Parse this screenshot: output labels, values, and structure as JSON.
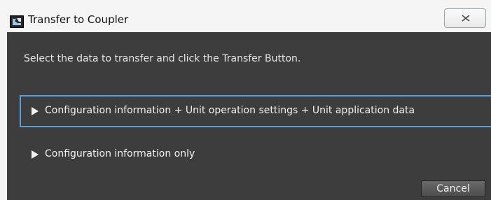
{
  "window": {
    "title": "Transfer to Coupler",
    "close_label": ""
  },
  "dialog": {
    "instruction": "Select the data to transfer and click the Transfer Button.",
    "options": [
      {
        "label": "Configuration information + Unit operation settings + Unit application data",
        "selected": true
      },
      {
        "label": "Configuration information only",
        "selected": false
      }
    ],
    "cancel_label": "Cancel"
  },
  "colors": {
    "panel_bg": "#3d3d3d",
    "selection_border": "#5aa0d8",
    "text": "#f2f2f2"
  },
  "icons": {
    "app": "app-window-icon",
    "close": "close-icon",
    "expand": "triangle-right-icon"
  }
}
